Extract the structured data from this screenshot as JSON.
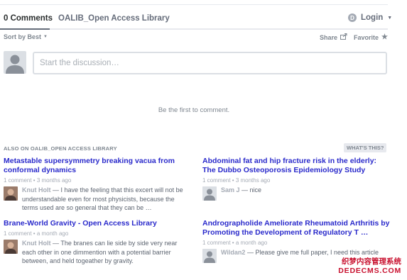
{
  "nav": {
    "comments_tab": "0 Comments",
    "forum_tab": "OALIB_Open Access Library",
    "login_label": "Login",
    "login_icon": "disqus-d-icon"
  },
  "toolbar": {
    "sort_label": "Sort by Best",
    "share_label": "Share",
    "favorite_label": "Favorite"
  },
  "composer": {
    "placeholder": "Start the discussion…"
  },
  "empty_state": "Be the first to comment.",
  "recommendations": {
    "header": "ALSO ON OALIB_OPEN ACCESS LIBRARY",
    "whats_this": "WHAT'S THIS?",
    "items": [
      {
        "title": "Metastable supersymmetry breaking vacua from conformal dynamics",
        "meta": "1 comment • 3 months ago",
        "author": "Knut Holt",
        "excerpt": " — I have the feeling that this excert will not be understandable even for most physicists, because the terms used are so general that they can be …"
      },
      {
        "title": "Abdominal fat and hip fracture risk in the elderly: The Dubbo Osteoporosis Epidemiology Study",
        "meta": "1 comment • 3 months ago",
        "author": "Sam J",
        "excerpt": " — nice"
      },
      {
        "title": "Brane-World Gravity - Open Access Library",
        "meta": "1 comment • a month ago",
        "author": "Knut Holt",
        "excerpt": " — The branes can lie side by side very near each other in one dimmention with a potential barrier between, and held togeather by gravity."
      },
      {
        "title": "Andrographolide Ameliorate Rheumatoid Arthritis by Promoting the Development of Regulatory T …",
        "meta": "1 comment • a month ago",
        "author": "Wildan2",
        "excerpt": " — Please give me full paper, I need this article"
      }
    ]
  },
  "watermark": {
    "line1": "织梦内容管理系统",
    "line2": "DEDECMS.COM"
  },
  "colors": {
    "link": "#2a2acb",
    "muted": "#7f8790",
    "border": "#dbdfe4",
    "watermark": "#c8102e"
  }
}
